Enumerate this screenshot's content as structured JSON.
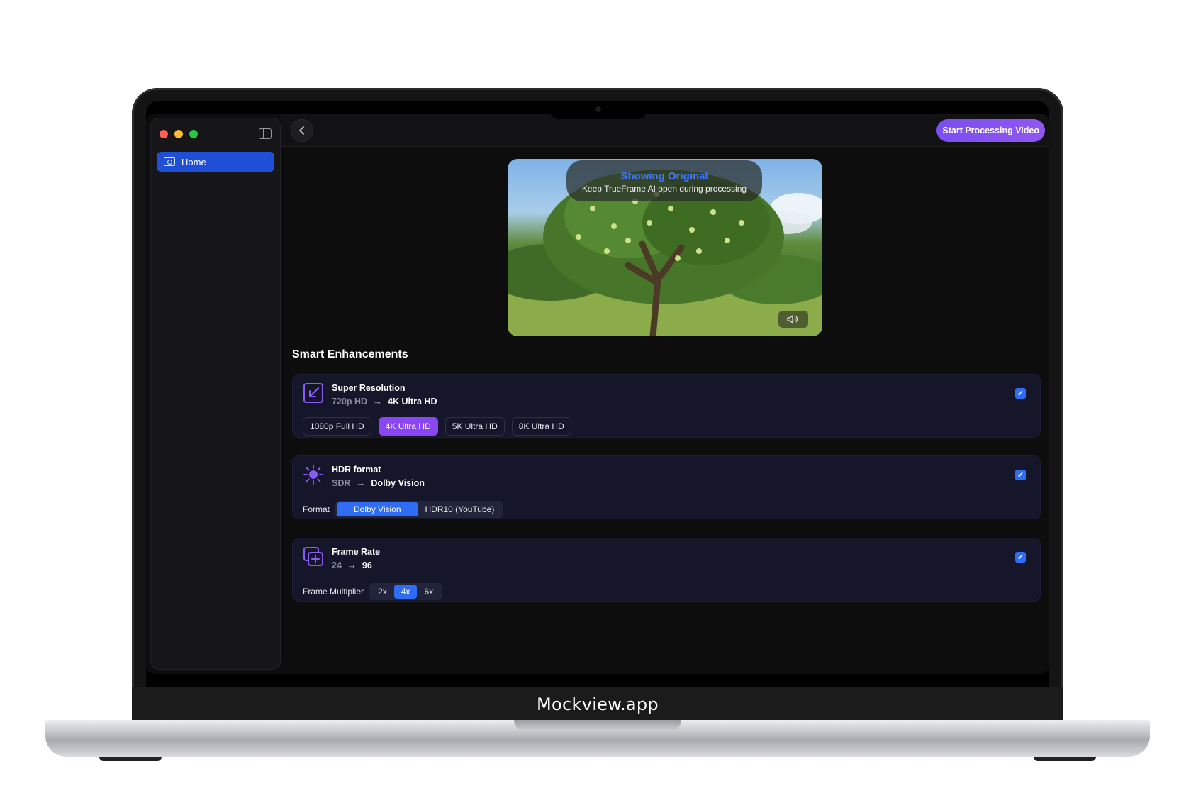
{
  "app": {
    "sidebar": {
      "items": [
        {
          "label": "Home",
          "icon": "home-icon",
          "active": true
        }
      ]
    },
    "toolbar": {
      "start_button_label": "Start Processing Video"
    },
    "video": {
      "overlay_title": "Showing Original",
      "overlay_subtitle": "Keep TrueFrame AI open during processing",
      "volume_icon": "speaker-icon"
    },
    "section_title": "Smart Enhancements",
    "cards": [
      {
        "title": "Super Resolution",
        "from": "720p HD",
        "to": "4K Ultra HD",
        "icon": "resize-icon",
        "checked": true,
        "options": [
          "1080p Full HD",
          "4K Ultra HD",
          "5K Ultra HD",
          "8K Ultra HD"
        ],
        "selected": "4K Ultra HD"
      },
      {
        "title": "HDR format",
        "from": "SDR",
        "to": "Dolby Vision",
        "icon": "sun-icon",
        "checked": true,
        "control_label": "Format",
        "options": [
          "Dolby Vision",
          "HDR10 (YouTube)"
        ],
        "selected": "Dolby Vision"
      },
      {
        "title": "Frame Rate",
        "from": "24",
        "to": "96",
        "icon": "frames-icon",
        "checked": true,
        "control_label": "Frame Multiplier",
        "options": [
          "2x",
          "4x",
          "6x"
        ],
        "selected": "4x"
      }
    ]
  },
  "device": {
    "bezel_label": "Mockview.app"
  },
  "colors": {
    "accent_blue": "#2f6df6",
    "accent_purple": "#8a46f0",
    "card_bg": "#15162a"
  }
}
